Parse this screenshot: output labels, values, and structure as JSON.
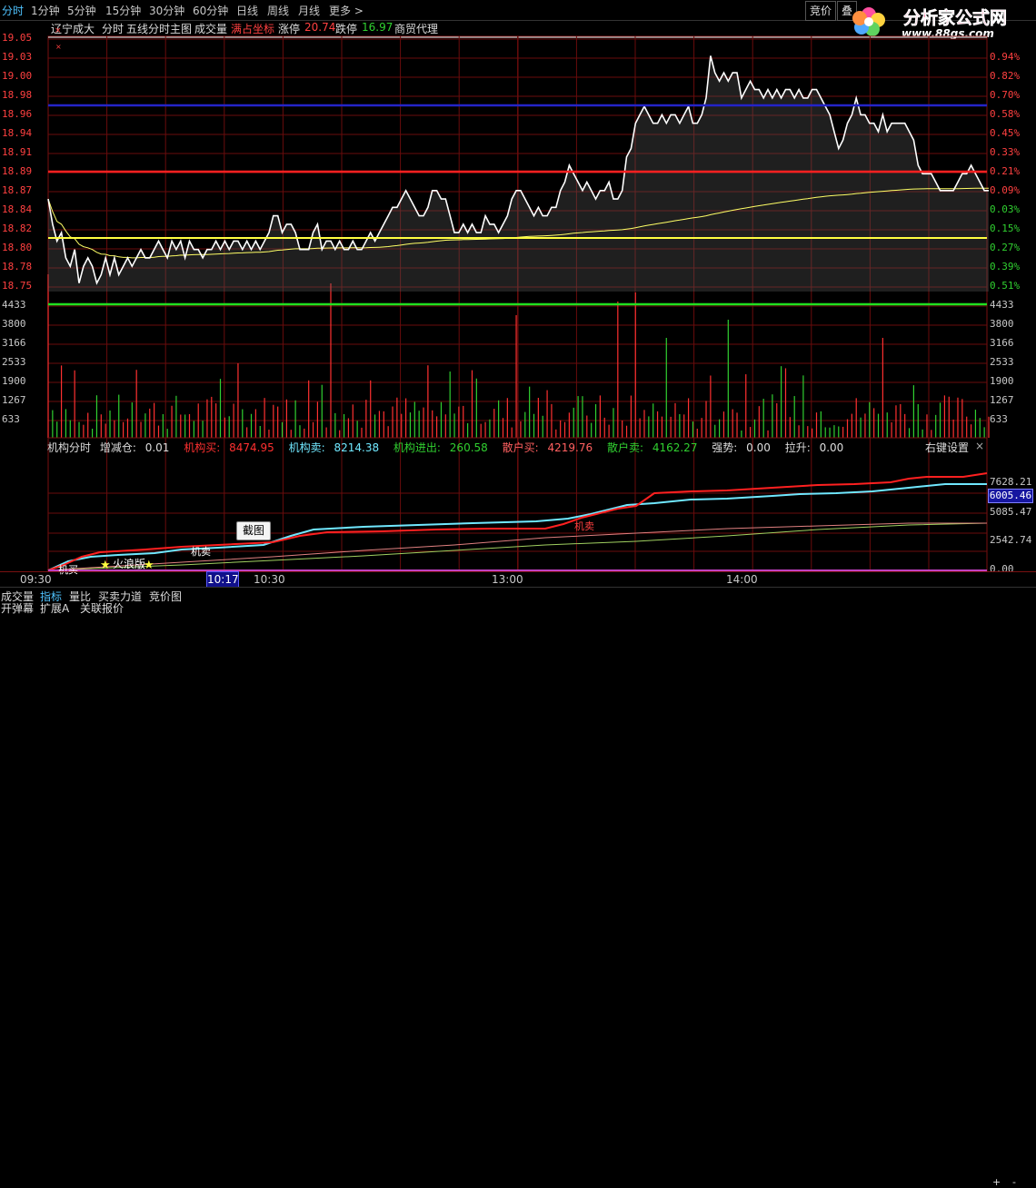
{
  "periods": [
    "分时",
    "1分钟",
    "5分钟",
    "15分钟",
    "30分钟",
    "60分钟",
    "日线",
    "周线",
    "月线",
    "更多 >"
  ],
  "active_period": "分时",
  "top_right": {
    "bid": "竞价",
    "overlay": "叠"
  },
  "logo": {
    "title": "分析家公式网",
    "url": "www.88gs.com"
  },
  "info": {
    "stock": "辽宁成大",
    "mode": "分时",
    "main_title": "五线分时主图",
    "volume": "成交量",
    "fill": "满占坐标",
    "limit_up_label": "涨停",
    "limit_up": "20.74",
    "limit_down_label": "跌停",
    "limit_down": "16.97",
    "agent": "商贸代理"
  },
  "price_labels": [
    "19.05",
    "19.03",
    "19.00",
    "18.98",
    "18.96",
    "18.94",
    "18.91",
    "18.89",
    "18.87",
    "18.84",
    "18.82",
    "18.80",
    "18.78",
    "18.75"
  ],
  "pct_labels": [
    "0.94%",
    "0.82%",
    "0.70%",
    "0.58%",
    "0.45%",
    "0.33%",
    "0.21%",
    "0.09%",
    "0.03%",
    "0.15%",
    "0.27%",
    "0.39%",
    "0.51%"
  ],
  "vol_labels": [
    "4433",
    "3800",
    "3166",
    "2533",
    "1900",
    "1267",
    "633"
  ],
  "indicator": {
    "name": "机构分时",
    "pos_label": "增减仓:",
    "pos": "0.01",
    "inst_buy_label": "机构买:",
    "inst_buy": "8474.95",
    "inst_sell_label": "机构卖:",
    "inst_sell": "8214.38",
    "inst_net_label": "机构进出:",
    "inst_net": "260.58",
    "retail_buy_label": "散户买:",
    "retail_buy": "4219.76",
    "retail_sell_label": "散户卖:",
    "retail_sell": "4162.27",
    "strength_label": "强势:",
    "strength": "0.00",
    "pull_label": "拉升:",
    "pull": "0.00",
    "right_settings": "右键设置",
    "close": "×"
  },
  "ind_labels": [
    "7628.21",
    "5085.47",
    "2542.74",
    "0.00"
  ],
  "ind_current": "6005.46",
  "annotations": {
    "star_text": "火浪版",
    "inst_sell_text": "机卖",
    "inst_sell_text2": "机卖",
    "inst_buy_text": "机买"
  },
  "screenshot_button": "截图",
  "time_labels": [
    "09:30",
    "10:30",
    "13:00",
    "14:00"
  ],
  "current_time": "10:17",
  "tabs": [
    "成交量",
    "指标",
    "量比",
    "买卖力道",
    "竞价图"
  ],
  "active_tab": "指标",
  "tabs2": [
    "开弹幕",
    "扩展A",
    "关联报价"
  ],
  "plus_minus": [
    "+",
    "-"
  ],
  "colors": {
    "price_line": "#ffffff",
    "avg_line": "#ffff66",
    "up": "#ff3030",
    "down": "#30d030",
    "blue_line": "#2222cc",
    "red_line": "#ff2020",
    "green_line": "#20e020",
    "yellow_line": "#ffff40"
  },
  "chart_data": {
    "type": "line",
    "price": [
      18.86,
      18.83,
      18.81,
      18.82,
      18.79,
      18.78,
      18.8,
      18.76,
      18.78,
      18.79,
      18.78,
      18.76,
      18.77,
      18.79,
      18.77,
      18.79,
      18.77,
      18.78,
      18.79,
      18.78,
      18.79,
      18.8,
      18.79,
      18.79,
      18.8,
      18.81,
      18.8,
      18.79,
      18.81,
      18.8,
      18.81,
      18.79,
      18.81,
      18.8,
      18.8,
      18.79,
      18.8,
      18.8,
      18.81,
      18.8,
      18.81,
      18.8,
      18.81,
      18.81,
      18.8,
      18.81,
      18.8,
      18.81,
      18.8,
      18.81,
      18.82,
      18.84,
      18.84,
      18.82,
      18.83,
      18.83,
      18.82,
      18.8,
      18.8,
      18.8,
      18.82,
      18.83,
      18.8,
      18.81,
      18.81,
      18.8,
      18.81,
      18.8,
      18.8,
      18.81,
      18.8,
      18.8,
      18.81,
      18.82,
      18.81,
      18.82,
      18.83,
      18.84,
      18.85,
      18.85,
      18.86,
      18.87,
      18.86,
      18.85,
      18.84,
      18.84,
      18.85,
      18.87,
      18.87,
      18.86,
      18.86,
      18.84,
      18.82,
      18.82,
      18.83,
      18.82,
      18.83,
      18.82,
      18.82,
      18.84,
      18.83,
      18.83,
      18.82,
      18.83,
      18.84,
      18.86,
      18.87,
      18.87,
      18.86,
      18.85,
      18.84,
      18.85,
      18.84,
      18.84,
      18.85,
      18.85,
      18.87,
      18.88,
      18.9,
      18.89,
      18.88,
      18.87,
      18.88,
      18.87,
      18.86,
      18.87,
      18.87,
      18.88,
      18.86,
      18.86,
      18.87,
      18.91,
      18.92,
      18.95,
      18.96,
      18.97,
      18.96,
      18.95,
      18.95,
      18.96,
      18.95,
      18.96,
      18.96,
      18.95,
      18.96,
      18.97,
      18.95,
      18.95,
      18.96,
      18.98,
      19.03,
      19.01,
      19.0,
      19.01,
      19.0,
      19.01,
      19.01,
      18.98,
      18.99,
      19.0,
      18.99,
      18.99,
      18.98,
      18.99,
      18.98,
      18.99,
      18.98,
      18.99,
      18.99,
      18.98,
      18.99,
      18.98,
      18.98,
      18.99,
      18.99,
      18.98,
      18.97,
      18.96,
      18.94,
      18.92,
      18.93,
      18.95,
      18.96,
      18.98,
      18.96,
      18.96,
      18.95,
      18.95,
      18.94,
      18.96,
      18.94,
      18.95,
      18.95,
      18.95,
      18.95,
      18.94,
      18.93,
      18.9,
      18.89,
      18.89,
      18.89,
      18.88,
      18.87,
      18.87,
      18.87,
      18.87,
      18.88,
      18.89,
      18.89,
      18.9,
      18.89,
      18.88,
      18.87,
      18.87
    ],
    "avg_line": "rises from 18.82 to about 18.88",
    "ylim": [
      18.75,
      19.05
    ]
  }
}
